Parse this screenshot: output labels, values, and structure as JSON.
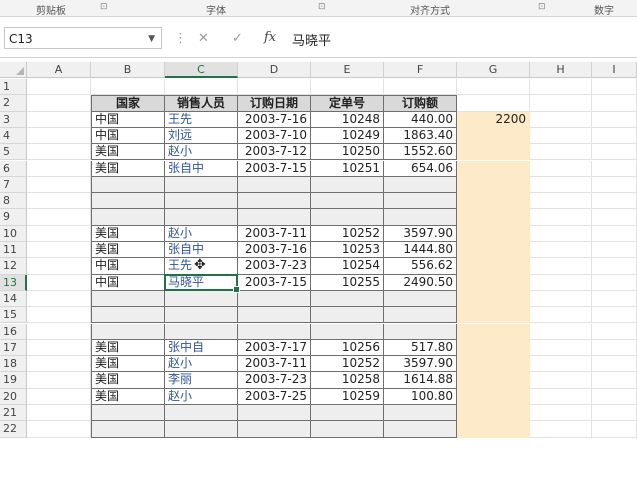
{
  "ribbon": {
    "groups": [
      "剪贴板",
      "字体",
      "对齐方式",
      "数字"
    ],
    "launcher_icon": "dialog-launcher-icon"
  },
  "formula_bar": {
    "name_box": "C13",
    "cancel_symbol": "✕",
    "enter_symbol": "✓",
    "fx_label": "fx",
    "value": "马晓平"
  },
  "columns": [
    "A",
    "B",
    "C",
    "D",
    "E",
    "F",
    "G",
    "H",
    "I"
  ],
  "selected_column": "C",
  "selected_row": "13",
  "table": {
    "headers": [
      "国家",
      "销售人员",
      "订购日期",
      "定单号",
      "订购额"
    ],
    "rows": [
      {
        "row": "1",
        "type": "empty"
      },
      {
        "row": "2",
        "type": "header"
      },
      {
        "row": "3",
        "type": "data",
        "cells": [
          "中国",
          "王先",
          "2003-7-16",
          "10248",
          "440.00"
        ],
        "g": "2200"
      },
      {
        "row": "4",
        "type": "data",
        "cells": [
          "中国",
          "刘远",
          "2003-7-10",
          "10249",
          "1863.40"
        ]
      },
      {
        "row": "5",
        "type": "data",
        "cells": [
          "美国",
          "赵小",
          "2003-7-12",
          "10250",
          "1552.60"
        ]
      },
      {
        "row": "6",
        "type": "data",
        "cells": [
          "美国",
          "张自中",
          "2003-7-15",
          "10251",
          "654.06"
        ]
      },
      {
        "row": "7",
        "type": "blank"
      },
      {
        "row": "8",
        "type": "blank"
      },
      {
        "row": "9",
        "type": "blank"
      },
      {
        "row": "10",
        "type": "data",
        "cells": [
          "美国",
          "赵小",
          "2003-7-11",
          "10252",
          "3597.90"
        ]
      },
      {
        "row": "11",
        "type": "data",
        "cells": [
          "美国",
          "张自中",
          "2003-7-16",
          "10253",
          "1444.80"
        ]
      },
      {
        "row": "12",
        "type": "data",
        "cells": [
          "中国",
          "王先",
          "2003-7-23",
          "10254",
          "556.62"
        ]
      },
      {
        "row": "13",
        "type": "data",
        "cells": [
          "中国",
          "马晓平",
          "2003-7-15",
          "10255",
          "2490.50"
        ]
      },
      {
        "row": "14",
        "type": "blank"
      },
      {
        "row": "15",
        "type": "blank"
      },
      {
        "row": "16",
        "type": "blank"
      },
      {
        "row": "17",
        "type": "data",
        "cells": [
          "美国",
          "张中自",
          "2003-7-17",
          "10256",
          "517.80"
        ]
      },
      {
        "row": "18",
        "type": "data",
        "cells": [
          "美国",
          "赵小",
          "2003-7-11",
          "10252",
          "3597.90"
        ]
      },
      {
        "row": "19",
        "type": "data",
        "cells": [
          "美国",
          "李丽",
          "2003-7-23",
          "10258",
          "1614.88"
        ]
      },
      {
        "row": "20",
        "type": "data",
        "cells": [
          "美国",
          "赵小",
          "2003-7-25",
          "10259",
          "100.80"
        ]
      },
      {
        "row": "21",
        "type": "blank"
      },
      {
        "row": "22",
        "type": "blank"
      }
    ]
  },
  "colors": {
    "accent": "#217346",
    "header_fill": "#d9d9d9",
    "blank_fill": "#eeeeee",
    "highlight_fill": "#fdeac8",
    "name_text": "#2f5597"
  }
}
